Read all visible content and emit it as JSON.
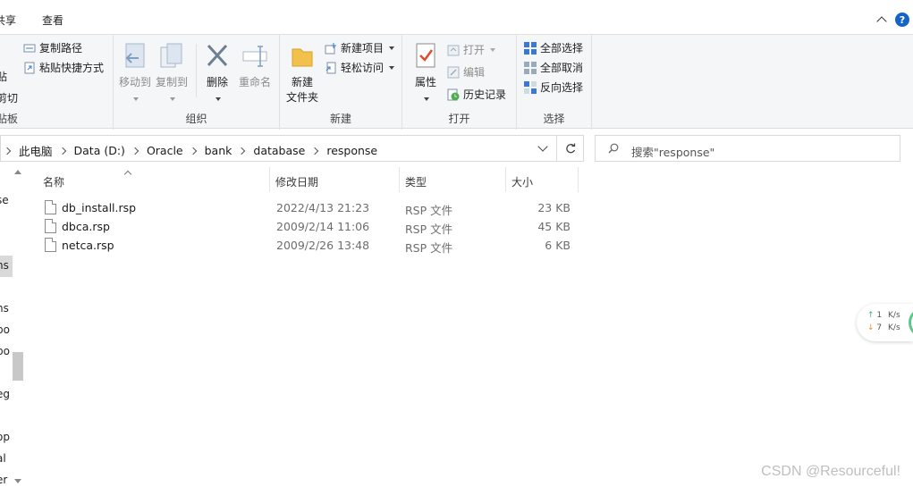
{
  "ribbon_tabs": {
    "share": "共享",
    "view": "查看"
  },
  "ribbon": {
    "clipboard": {
      "copy_path": "复制路径",
      "paste_shortcut": "粘贴快捷方式",
      "paste_frag": "贴",
      "cut_frag": "剪切",
      "label_frag": "贴板"
    },
    "organize": {
      "move_to": "移动到",
      "copy_to": "复制到",
      "delete": "删除",
      "rename": "重命名",
      "label": "组织"
    },
    "new": {
      "new_folder_line1": "新建",
      "new_folder_line2": "文件夹",
      "new_item": "新建项目",
      "easy_access": "轻松访问",
      "label": "新建"
    },
    "open": {
      "properties": "属性",
      "open": "打开",
      "edit": "编辑",
      "history": "历史记录",
      "label": "打开"
    },
    "select": {
      "select_all": "全部选择",
      "select_none": "全部取消",
      "invert": "反向选择",
      "label": "选择"
    }
  },
  "address": {
    "crumbs": [
      "此电脑",
      "Data (D:)",
      "Oracle",
      "bank",
      "database",
      "response"
    ]
  },
  "search": {
    "placeholder": "搜索\"response\""
  },
  "nav_fragments": [
    "se",
    "ns",
    "ns",
    "po",
    "po",
    "eg",
    "op",
    "al",
    "er"
  ],
  "columns": {
    "name": "名称",
    "date": "修改日期",
    "type": "类型",
    "size": "大小"
  },
  "files": [
    {
      "name": "db_install.rsp",
      "date": "2022/4/13 21:23",
      "type": "RSP 文件",
      "size": "23 KB"
    },
    {
      "name": "dbca.rsp",
      "date": "2009/2/14 11:06",
      "type": "RSP 文件",
      "size": "45 KB"
    },
    {
      "name": "netca.rsp",
      "date": "2009/2/26 13:48",
      "type": "RSP 文件",
      "size": "6 KB"
    }
  ],
  "speed": {
    "up": "1",
    "down": "7",
    "unit": "K/s"
  },
  "watermark": "CSDN @Resourceful!"
}
